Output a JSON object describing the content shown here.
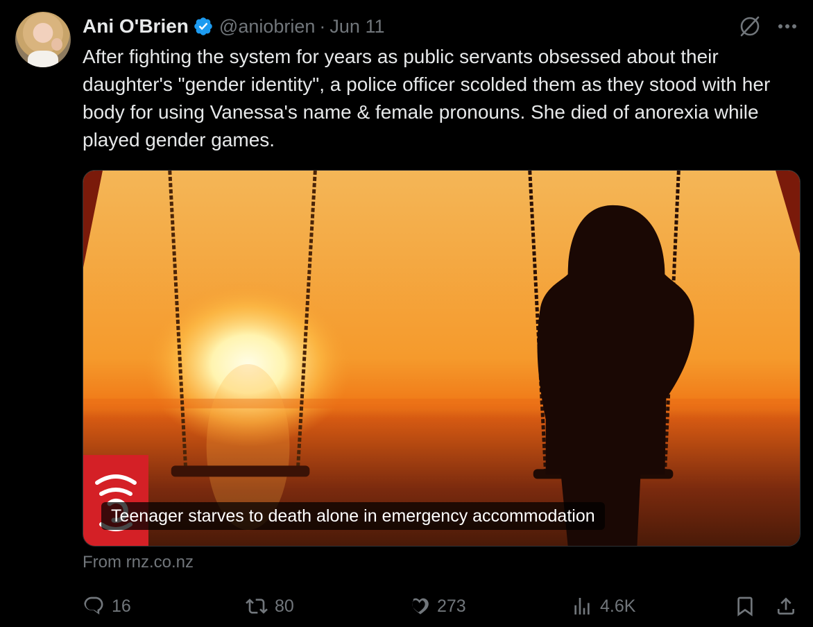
{
  "tweet": {
    "author_name": "Ani O'Brien",
    "handle": "@aniobrien",
    "separator": "·",
    "date": "Jun 11",
    "text": "After fighting the system for years as public servants obsessed about their daughter's \"gender identity\", a police officer scolded them as they stood with her body for using Vanessa's name & female pronouns. She died of anorexia while played gender games."
  },
  "card": {
    "caption": "Teenager starves to death alone in emergency accommodation",
    "source": "From rnz.co.nz",
    "logo": "rnz-logo"
  },
  "metrics": {
    "replies": "16",
    "reposts": "80",
    "likes": "273",
    "views": "4.6K"
  },
  "icons": {
    "verified": "verified-badge-icon",
    "grok": "grok-icon",
    "more": "more-icon",
    "reply": "reply-icon",
    "repost": "repost-icon",
    "like": "heart-icon",
    "views": "views-icon",
    "bookmark": "bookmark-icon",
    "share": "share-icon"
  },
  "colors": {
    "background": "#000000",
    "text": "#e7e9ea",
    "muted": "#71767b",
    "verified": "#1d9bf0",
    "rnz_red": "#d42026"
  }
}
